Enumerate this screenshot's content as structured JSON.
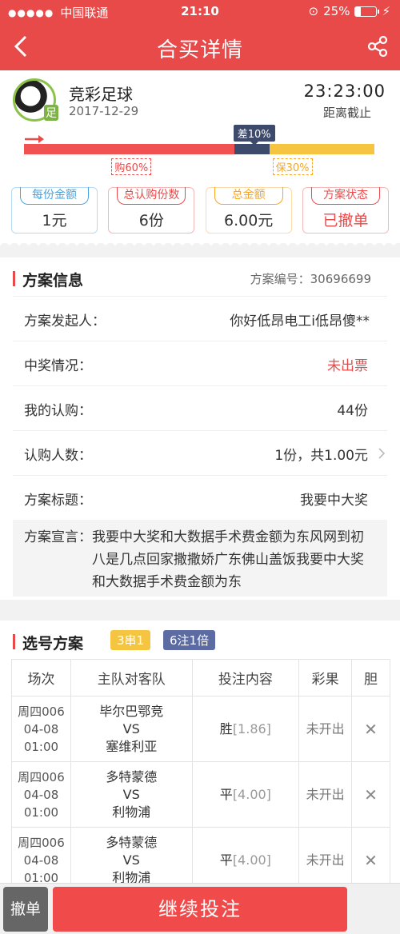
{
  "status_bar": {
    "carrier": "中国联通",
    "time": "21:10",
    "battery": "25%",
    "signal_dots": "●●●●●"
  },
  "nav": {
    "title": "合买详情"
  },
  "header": {
    "lottery_name": "竞彩足球",
    "date": "2017-12-29",
    "countdown": "23:23:00",
    "deadline_label": "距离截止",
    "icon_badge": "足",
    "progress": {
      "bought_pct": 60,
      "diff_pct": 10,
      "guarantee_pct": 30
    },
    "diff_label": "差10%",
    "bought_label": "购60%",
    "guarantee_label": "保30%",
    "colors": {
      "bought": "#f05252",
      "diff": "#3d4a6b",
      "guarantee": "#f5c542"
    }
  },
  "stats": [
    {
      "label": "每份金额",
      "value": "1元",
      "color": "#4aa3df"
    },
    {
      "label": "总认购份数",
      "value": "6份",
      "color": "#e84a4a"
    },
    {
      "label": "总金额",
      "value": "6.00元",
      "color": "#f5a623"
    },
    {
      "label": "方案状态",
      "value": "已撤单",
      "color": "#e84a4a"
    }
  ],
  "info": {
    "title": "方案信息",
    "plan_no": "方案编号：30696699",
    "rows": [
      {
        "key": "方案发起人：",
        "value": "你好低昂电工i低昂傻**"
      },
      {
        "key": "中奖情况：",
        "value": "未出票"
      },
      {
        "key": "我的认购：",
        "value": "44份"
      },
      {
        "key": "认购人数：",
        "value": "1份，共1.00元"
      },
      {
        "key": "方案标题：",
        "value": "我要中大奖"
      }
    ],
    "declaration_key": "方案宣言：",
    "declaration": "我要中大奖和大数据手术费金额为东风网到初八是几点回家撒撒娇广东佛山盖饭我要中大奖和大数据手术费金额为东"
  },
  "selection": {
    "title": "选号方案",
    "badge1": "3串1",
    "badge2": "6注1倍",
    "headers": [
      "场次",
      "主队对客队",
      "投注内容",
      "彩果",
      "胆"
    ],
    "rows": [
      {
        "no": "周四006",
        "date": "04-08",
        "time": "01:00",
        "home": "毕尔巴鄂竞",
        "vs": "VS",
        "away": "塞维利亚",
        "bet": "胜",
        "odd": "[1.86]",
        "result": "未开出",
        "dan": "✕"
      },
      {
        "no": "周四006",
        "date": "04-08",
        "time": "01:00",
        "home": "多特蒙德",
        "vs": "VS",
        "away": "利物浦",
        "bet": "平",
        "odd": "[4.00]",
        "result": "未开出",
        "dan": "✕"
      },
      {
        "no": "周四006",
        "date": "04-08",
        "time": "01:00",
        "home": "多特蒙德",
        "vs": "VS",
        "away": "利物浦",
        "bet": "平",
        "odd": "[4.00]",
        "result": "未开出",
        "dan": "✕"
      }
    ]
  },
  "bottom": {
    "cancel": "撤单",
    "continue": "继续投注"
  }
}
